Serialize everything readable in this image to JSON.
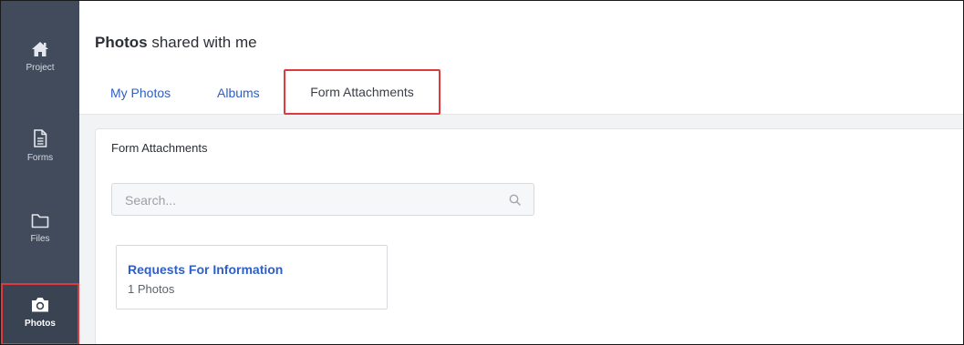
{
  "sidebar": {
    "items": [
      {
        "label": "Project",
        "icon": "home-icon"
      },
      {
        "label": "Forms",
        "icon": "document-icon"
      },
      {
        "label": "Files",
        "icon": "folder-icon"
      },
      {
        "label": "Photos",
        "icon": "camera-icon",
        "active": true
      }
    ]
  },
  "header": {
    "title_bold": "Photos",
    "title_rest": " shared with me",
    "tabs": [
      {
        "label": "My Photos"
      },
      {
        "label": "Albums"
      },
      {
        "label": "Form Attachments",
        "active": true
      }
    ]
  },
  "main": {
    "card_title": "Form Attachments",
    "search_placeholder": "Search...",
    "tiles": [
      {
        "name": "Requests For Information",
        "count": "1 Photos"
      }
    ]
  },
  "colors": {
    "sidebar_bg": "#414b5b",
    "link_blue": "#2f5fc4",
    "highlight_red": "#e0393b"
  }
}
